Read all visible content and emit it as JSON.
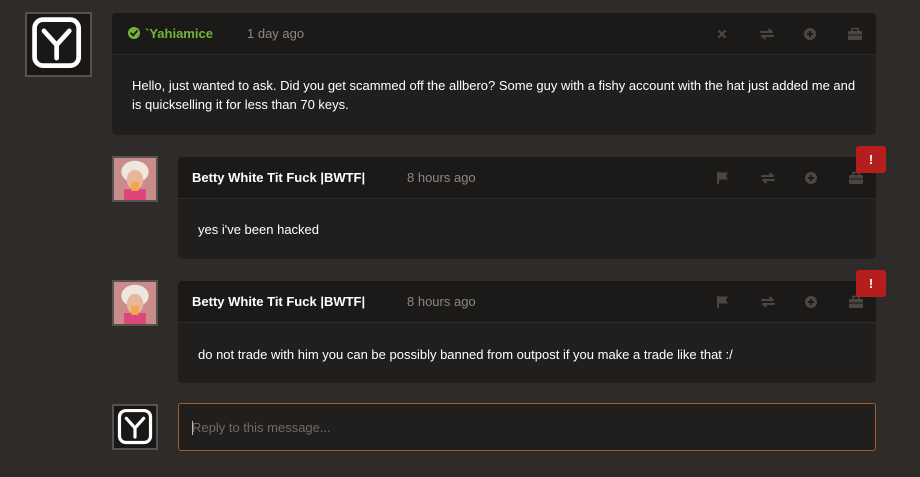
{
  "messages": [
    {
      "author": "`Yahiamice",
      "time": "1 day ago",
      "body": "Hello, just wanted to ask. Did you get scammed off the allbero? Some guy with a fishy account with the hat just added me and is quickselling it for less than 70 keys.",
      "verified": true,
      "actions": [
        "close-icon",
        "swap-icon",
        "add-icon",
        "briefcase-icon"
      ]
    },
    {
      "author": "Betty White Tit Fuck |BWTF|",
      "time": "8 hours ago",
      "body": "yes i've been hacked",
      "badge": "!",
      "actions": [
        "flag-icon",
        "swap-icon",
        "add-icon",
        "briefcase-icon"
      ]
    },
    {
      "author": "Betty White Tit Fuck |BWTF|",
      "time": "8 hours ago",
      "body": "do not trade with him you can be possibly banned from outpost if you make a trade like that :/",
      "badge": "!",
      "actions": [
        "flag-icon",
        "swap-icon",
        "add-icon",
        "briefcase-icon"
      ]
    }
  ],
  "reply": {
    "placeholder": "Reply to this message..."
  },
  "colors": {
    "accent_green": "#74b33a",
    "badge_red": "#b61d1d",
    "reply_border": "#a25d2a"
  }
}
